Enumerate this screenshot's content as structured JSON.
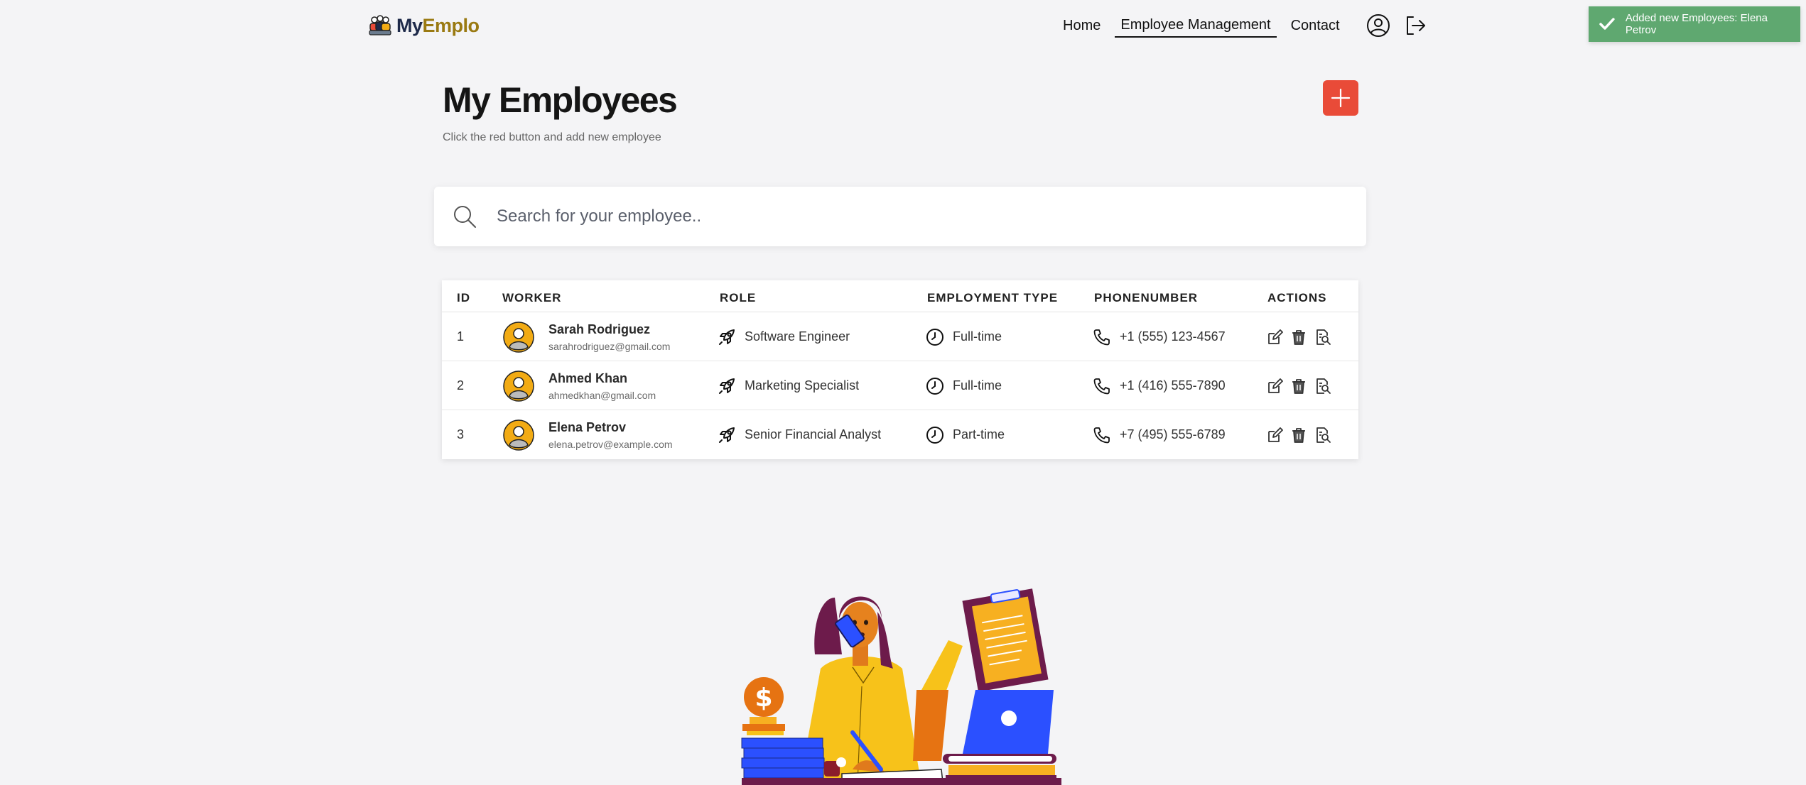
{
  "brand": {
    "part1": "My",
    "part2": "Emplo"
  },
  "nav": {
    "items": [
      {
        "label": "Home"
      },
      {
        "label": "Employee Management"
      },
      {
        "label": "Contact"
      }
    ]
  },
  "toast": {
    "message": "Added new Employees: Elena Petrov"
  },
  "page": {
    "title": "My Employees",
    "subtitle": "Click the red button and add new employee"
  },
  "search": {
    "placeholder": "Search for your employee.."
  },
  "table": {
    "headers": [
      "ID",
      "WORKER",
      "ROLE",
      "EMPLOYMENT TYPE",
      "PHONENUMBER",
      "ACTIONS"
    ],
    "rows": [
      {
        "id": "1",
        "name": "Sarah Rodriguez",
        "email": "sarahrodriguez@gmail.com",
        "role": "Software Engineer",
        "type": "Full-time",
        "phone": "+1 (555) 123-4567"
      },
      {
        "id": "2",
        "name": "Ahmed Khan",
        "email": "ahmedkhan@gmail.com",
        "role": "Marketing Specialist",
        "type": "Full-time",
        "phone": "+1 (416) 555-7890"
      },
      {
        "id": "3",
        "name": "Elena Petrov",
        "email": "elena.petrov@example.com",
        "role": "Senior Financial Analyst",
        "type": "Part-time",
        "phone": "+7 (495) 555-6789"
      }
    ]
  },
  "colors": {
    "accent_red": "#e94b38",
    "toast_green": "#5fa870",
    "avatar_yellow": "#f2ab14",
    "background": "#f4f4f6"
  },
  "icons": {
    "logo": "people-group-icon",
    "profile": "user-circle-icon",
    "logout": "logout-icon",
    "add": "plus-icon",
    "search": "search-icon",
    "role": "rocket-icon",
    "type": "clock-icon",
    "phone": "phone-icon",
    "edit": "edit-icon",
    "delete": "trash-icon",
    "view": "document-search-icon",
    "toast": "checkmark-icon"
  }
}
